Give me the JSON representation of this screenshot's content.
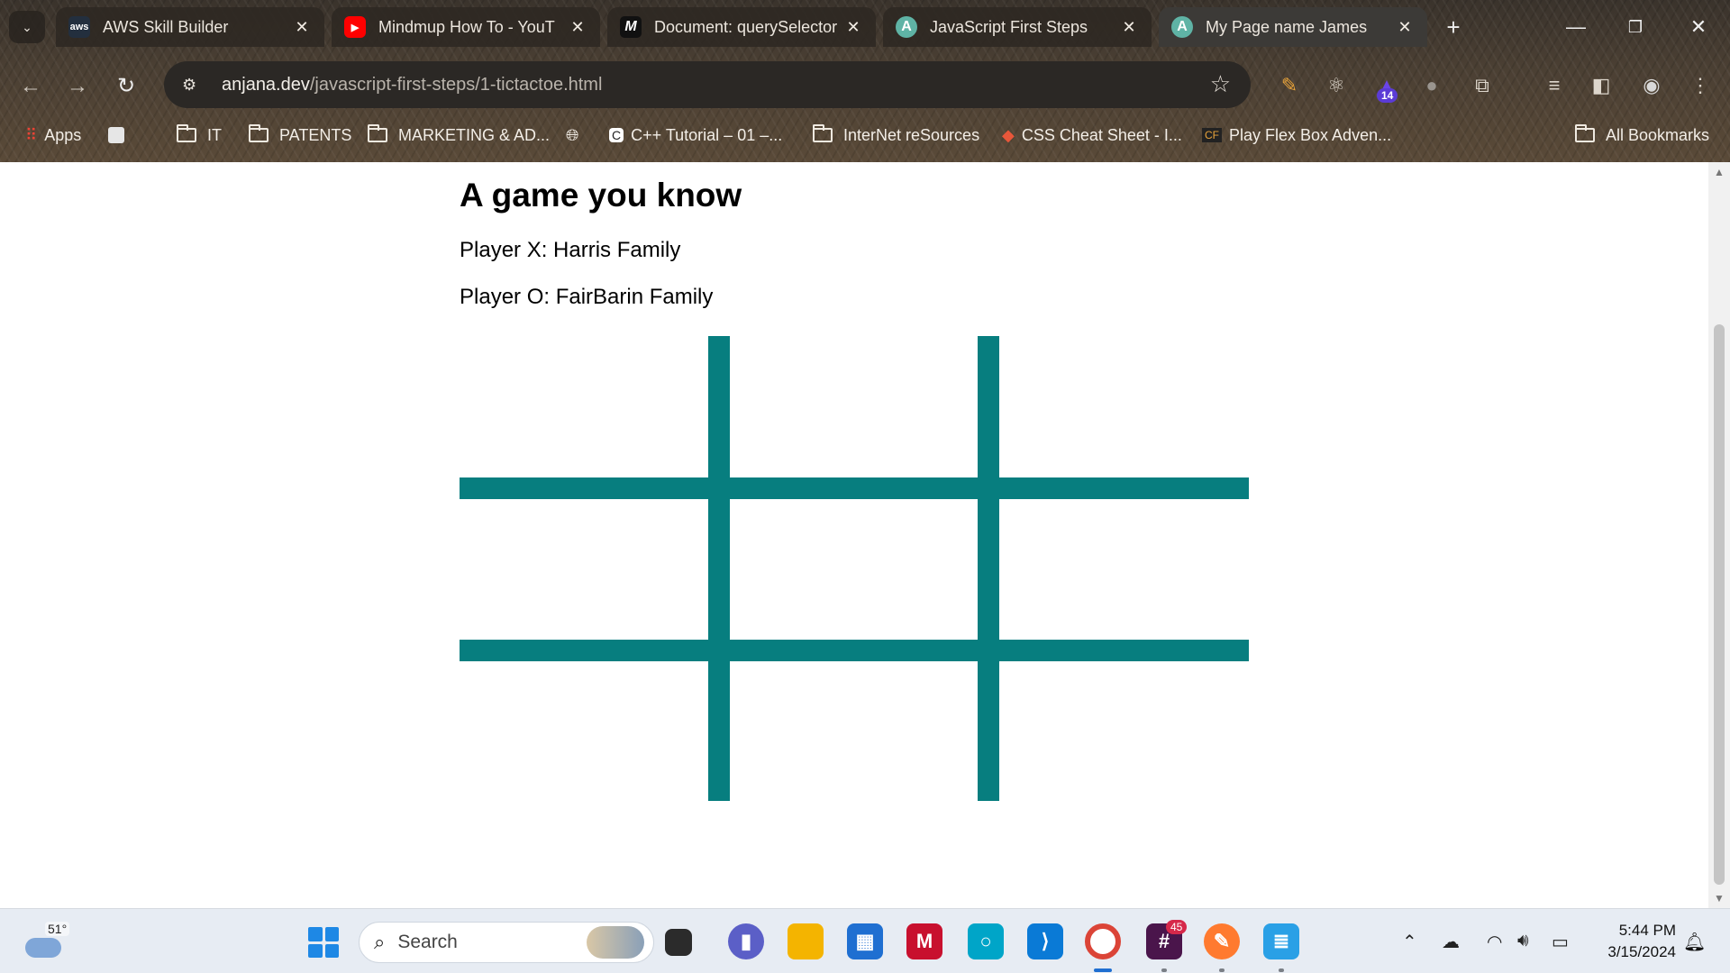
{
  "browser": {
    "tabs": [
      {
        "title": "AWS Skill Builder",
        "favicon": "aws-icon",
        "favicon_text": "aws",
        "color": "#232f3e"
      },
      {
        "title": "Mindmup How To - YouT",
        "favicon": "youtube-icon",
        "favicon_text": "▶",
        "color": "#ff0000"
      },
      {
        "title": "Document: querySelector",
        "favicon": "mdn-icon",
        "favicon_text": "M",
        "color": "#111111"
      },
      {
        "title": "JavaScript First Steps",
        "favicon": "anjana-icon",
        "favicon_text": "A",
        "color": "#5fb3a5"
      },
      {
        "title": "My Page name James",
        "favicon": "anjana-icon",
        "favicon_text": "A",
        "color": "#5fb3a5"
      }
    ],
    "active_tab_index": 4,
    "new_tab_symbol": "+",
    "url_domain": "anjana.dev",
    "url_path": "/javascript-first-steps/1-tictactoe.html",
    "extensions": [
      "colorzilla-icon",
      "react-devtools-icon",
      "extension-wizard-icon",
      "extension-pin-icon",
      "extensions-puzzle-icon"
    ],
    "extension_badge": "14",
    "bookmarks": [
      {
        "label": "Apps",
        "type": "apps"
      },
      {
        "label": "",
        "type": "square"
      },
      {
        "label": "IT",
        "type": "folder"
      },
      {
        "label": "PATENTS",
        "type": "folder"
      },
      {
        "label": "MARKETING & AD...",
        "type": "folder"
      },
      {
        "label": "",
        "type": "globe"
      },
      {
        "label": "C++ Tutorial – 01 –...",
        "type": "site"
      },
      {
        "label": "InterNet reSources",
        "type": "folder"
      },
      {
        "label": "CSS Cheat Sheet - I...",
        "type": "site"
      },
      {
        "label": "Play Flex Box Adven...",
        "type": "site"
      }
    ],
    "all_bookmarks": "All Bookmarks"
  },
  "page": {
    "heading": "A game you know",
    "player_x": "Player X: Harris Family",
    "player_o": "Player O: FairBarin Family",
    "board_color": "#077e7f"
  },
  "taskbar": {
    "temperature": "51°",
    "search_placeholder": "Search",
    "slack_badge": "45",
    "time": "5:44 PM",
    "date": "3/15/2024"
  }
}
